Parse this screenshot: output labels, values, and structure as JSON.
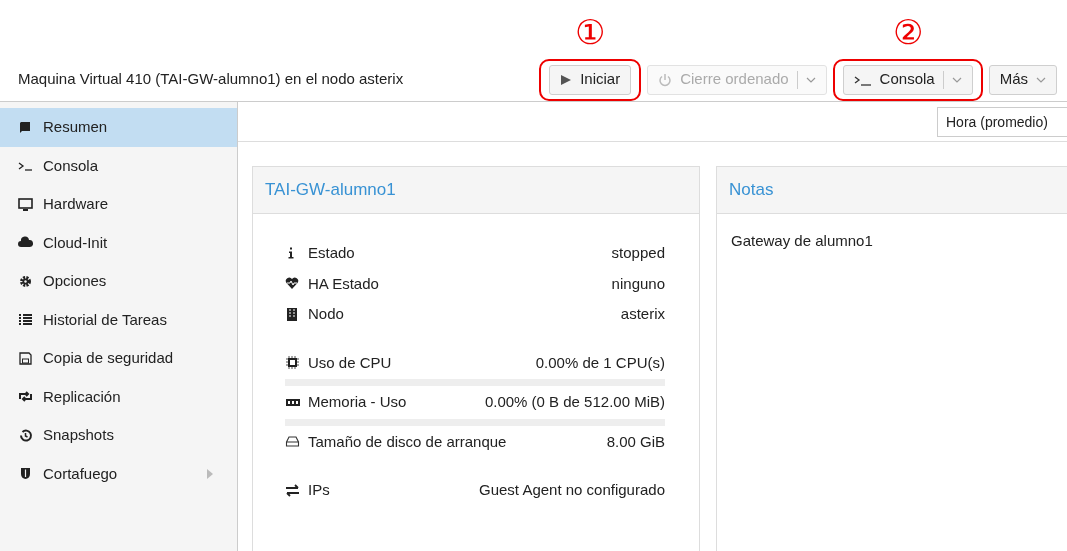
{
  "header": {
    "title": "Maquina Virtual 410 (TAI-GW-alumno1) en el nodo asterix"
  },
  "toolbar": [
    {
      "kind": "button",
      "label": "Iniciar",
      "disabled": false,
      "annotation": "①"
    },
    {
      "kind": "split",
      "label": "Cierre ordenado",
      "disabled": true
    },
    {
      "kind": "split",
      "label": "Consola",
      "disabled": false,
      "annotation": "②"
    },
    {
      "kind": "menu",
      "label": "Más",
      "disabled": false
    }
  ],
  "sidebar": {
    "items": [
      {
        "label": "Resumen",
        "selected": true
      },
      {
        "label": "Consola",
        "selected": false
      },
      {
        "label": "Hardware",
        "selected": false
      },
      {
        "label": "Cloud-Init",
        "selected": false
      },
      {
        "label": "Opciones",
        "selected": false
      },
      {
        "label": "Historial de Tareas",
        "selected": false
      },
      {
        "label": "Copia de seguridad",
        "selected": false
      },
      {
        "label": "Replicación",
        "selected": false
      },
      {
        "label": "Snapshots",
        "selected": false
      },
      {
        "label": "Cortafuego",
        "selected": false,
        "has_submenu": true
      }
    ]
  },
  "timeframe": {
    "value": "Hora (promedio)"
  },
  "summary": {
    "title": "TAI-GW-alumno1",
    "groups": [
      [
        {
          "label": "Estado",
          "value": "stopped"
        },
        {
          "label": "HA Estado",
          "value": "ninguno"
        },
        {
          "label": "Nodo",
          "value": "asterix"
        }
      ],
      [
        {
          "label": "Uso de CPU",
          "value": "0.00% de 1 CPU(s)",
          "level": 0
        },
        {
          "label": "Memoria - Uso",
          "value": "0.00% (0 B de 512.00 MiB)",
          "level": 0
        },
        {
          "label": "Tamaño de disco de arranque",
          "value": "8.00 GiB"
        }
      ],
      [
        {
          "label": "IPs",
          "value": "Guest Agent no configurado"
        }
      ]
    ]
  },
  "notes": {
    "title": "Notas",
    "text": "Gateway de alumno1"
  }
}
